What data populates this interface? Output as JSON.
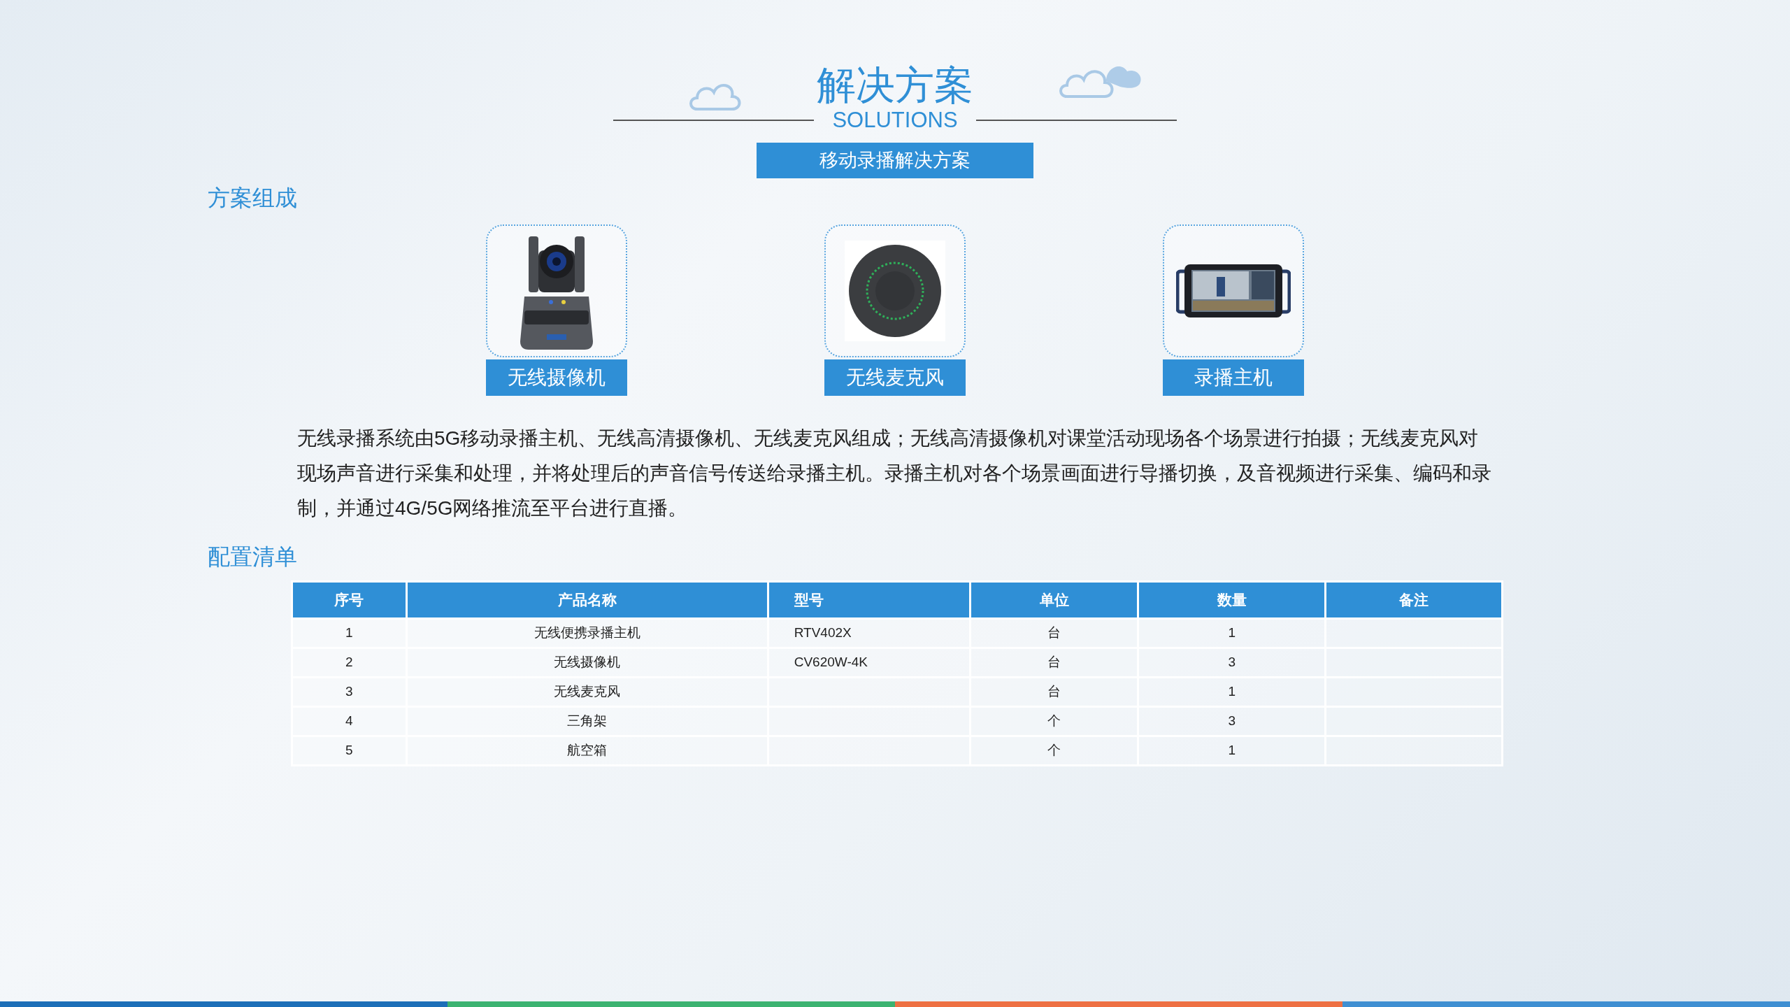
{
  "header": {
    "title": "解决方案",
    "subtitle": "SOLUTIONS",
    "banner": "移动录播解决方案"
  },
  "composition": {
    "heading": "方案组成",
    "products": [
      {
        "kind": "camera",
        "label": "无线摄像机"
      },
      {
        "kind": "microphone",
        "label": "无线麦克风"
      },
      {
        "kind": "recorder",
        "label": "录播主机"
      }
    ],
    "description": "无线录播系统由5G移动录播主机、无线高清摄像机、无线麦克风组成；无线高清摄像机对课堂活动现场各个场景进行拍摄；无线麦克风对现场声音进行采集和处理，并将处理后的声音信号传送给录播主机。录播主机对各个场景画面进行导播切换，及音视频进行采集、编码和录制，并通过4G/5G网络推流至平台进行直播。"
  },
  "config": {
    "heading": "配置清单",
    "table": {
      "columns": [
        "序号",
        "产品名称",
        "型号",
        "单位",
        "数量",
        "备注"
      ],
      "rows": [
        [
          "1",
          "无线便携录播主机",
          "RTV402X",
          "台",
          "1",
          null
        ],
        [
          "2",
          "无线摄像机",
          "CV620W-4K",
          "台",
          "3",
          null
        ],
        [
          "3",
          "无线麦克风",
          null,
          "台",
          "1",
          null
        ],
        [
          "4",
          "三角架",
          null,
          "个",
          "3",
          null
        ],
        [
          "5",
          "航空箱",
          null,
          "个",
          "1",
          null
        ]
      ]
    }
  }
}
